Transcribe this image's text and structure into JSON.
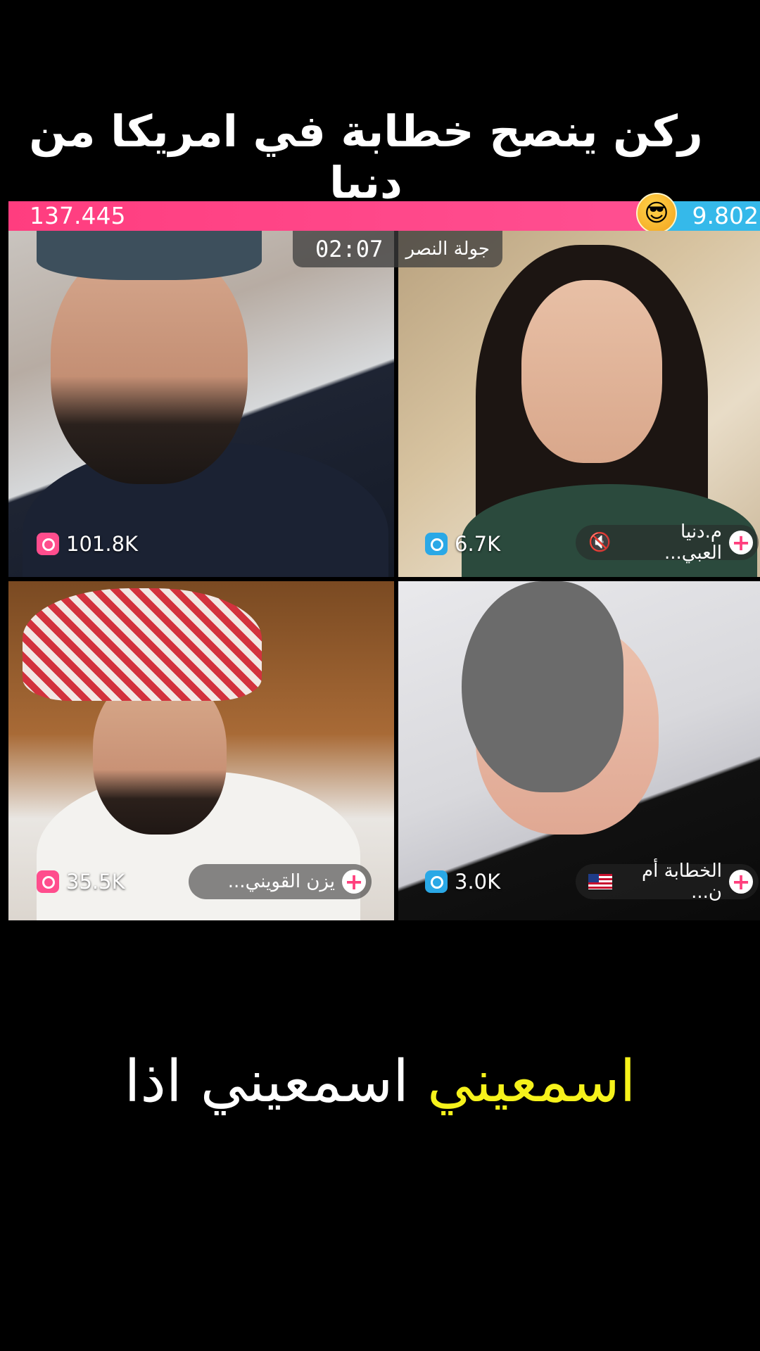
{
  "headline": "ركن ينصح خطابة في امريكا من دنيا",
  "battle": {
    "left_score": "137.445",
    "right_score": "9.802",
    "emoji": "😎",
    "timer": "02:07",
    "round_label": "جولة النصر"
  },
  "tiles": [
    {
      "count": "101.8K",
      "name": ""
    },
    {
      "count": "6.7K",
      "name": "م.دنيا العبي..."
    },
    {
      "count": "35.5K",
      "name": "يزن القويني..."
    },
    {
      "count": "3.0K",
      "name": "الخطابة أم ن..."
    }
  ],
  "subtitle": {
    "highlight": "اسمعيني",
    "rest": "اسمعيني اذا"
  },
  "colors": {
    "left_team": "#ff4f91",
    "right_team": "#35b9ea",
    "subtitle_highlight": "#f6f21b"
  }
}
